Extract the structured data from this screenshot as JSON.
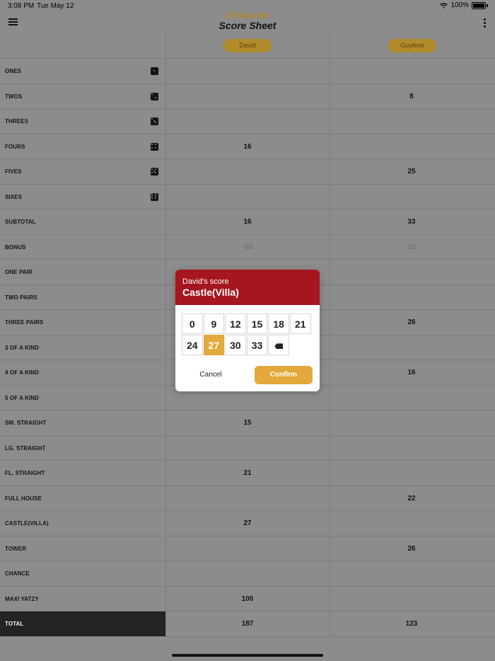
{
  "status_bar": {
    "time": "3:08 PM",
    "date": "Tue May 12",
    "battery": "100%"
  },
  "header": {
    "subtitle": "20 Rounds",
    "title": "Score Sheet"
  },
  "players": [
    "David",
    "Guylène"
  ],
  "rows": [
    {
      "label": "ONES",
      "die": 1,
      "scores": [
        "",
        ""
      ]
    },
    {
      "label": "TWOS",
      "die": 2,
      "scores": [
        "",
        "8"
      ]
    },
    {
      "label": "THREES",
      "die": 3,
      "scores": [
        "",
        ""
      ]
    },
    {
      "label": "FOURS",
      "die": 4,
      "scores": [
        "16",
        ""
      ]
    },
    {
      "label": "FIVES",
      "die": 5,
      "scores": [
        "",
        "25"
      ]
    },
    {
      "label": "SIXES",
      "die": 6,
      "scores": [
        "",
        ""
      ]
    },
    {
      "label": "SUBTOTAL",
      "scores": [
        "16",
        "33"
      ]
    },
    {
      "label": "BONUS",
      "muted": true,
      "scores": [
        "-68",
        "-51"
      ]
    },
    {
      "label": "ONE PAIR",
      "scores": [
        "",
        ""
      ]
    },
    {
      "label": "TWO PAIRS",
      "scores": [
        "",
        ""
      ]
    },
    {
      "label": "THREE PAIRS",
      "scores": [
        "",
        "26"
      ]
    },
    {
      "label": "3 OF A KIND",
      "scores": [
        "",
        ""
      ]
    },
    {
      "label": "4 OF A KIND",
      "scores": [
        "",
        "16"
      ]
    },
    {
      "label": "5 OF A KIND",
      "scores": [
        "",
        ""
      ]
    },
    {
      "label": "SM. STRAIGHT",
      "scores": [
        "15",
        ""
      ]
    },
    {
      "label": "LG. STRAIGHT",
      "scores": [
        "",
        ""
      ]
    },
    {
      "label": "FL. STRAIGHT",
      "scores": [
        "21",
        ""
      ]
    },
    {
      "label": "FULL HOUSE",
      "scores": [
        "",
        "22"
      ]
    },
    {
      "label": "CASTLE(VILLA)",
      "scores": [
        "27",
        ""
      ]
    },
    {
      "label": "TOWER",
      "scores": [
        "",
        "26"
      ]
    },
    {
      "label": "CHANCE",
      "scores": [
        "",
        ""
      ]
    },
    {
      "label": "MAXI YATZY",
      "scores": [
        "100",
        ""
      ]
    },
    {
      "label": "TOTAL",
      "total": true,
      "scores": [
        "187",
        "123"
      ]
    }
  ],
  "dialog": {
    "subtitle": "David's score",
    "title": "Castle(Villa)",
    "keys": [
      "0",
      "9",
      "12",
      "15",
      "18",
      "21",
      "24",
      "27",
      "30",
      "33"
    ],
    "selected_key": "27",
    "cancel_label": "Cancel",
    "confirm_label": "Confirm"
  },
  "colors": {
    "accent": "#e3a93c",
    "dialog_header": "#a5161f",
    "overlay_background": "#8c8c8c",
    "total_label_background": "#232323"
  }
}
